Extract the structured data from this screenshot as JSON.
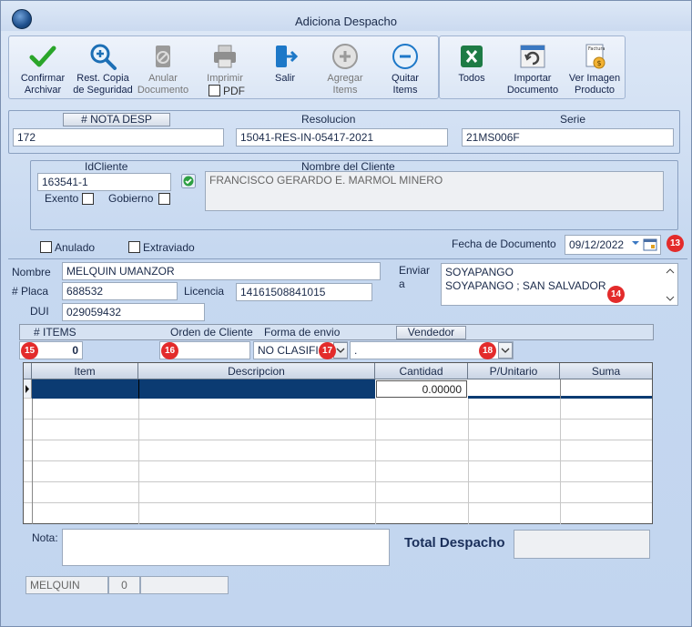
{
  "window": {
    "title": "Adiciona Despacho"
  },
  "toolbar": {
    "confirmar": [
      "Confirmar",
      "Archivar"
    ],
    "rest": [
      "Rest. Copia",
      "de Seguridad"
    ],
    "anular": [
      "Anular",
      "Documento"
    ],
    "imprimir": "Imprimir",
    "pdf": "PDF",
    "salir": "Salir",
    "agregar": [
      "Agregar",
      "Items"
    ],
    "quitar": [
      "Quitar",
      "Items"
    ],
    "todos": "Todos",
    "importar": [
      "Importar",
      "Documento"
    ],
    "ver_imagen": [
      "Ver Imagen",
      "Producto"
    ],
    "factura_mini": "Factura"
  },
  "header": {
    "nota_label": "# NOTA DESP",
    "nota_value": "172",
    "resolucion_label": "Resolucion",
    "resolucion_value": "15041-RES-IN-05417-2021",
    "serie_label": "Serie",
    "serie_value": "21MS006F"
  },
  "cliente": {
    "id_label": "IdCliente",
    "id_value": "163541-1",
    "nombre_label": "Nombre del Cliente",
    "nombre_value": "FRANCISCO GERARDO E. MARMOL MINERO",
    "exento_label": "Exento",
    "gobierno_label": "Gobierno"
  },
  "flags": {
    "anulado": "Anulado",
    "extraviado": "Extraviado"
  },
  "fecha": {
    "label": "Fecha de Documento",
    "value": "09/12/2022"
  },
  "transporte": {
    "nombre_label": "Nombre",
    "nombre_value": "MELQUIN UMANZOR",
    "placa_label": "# Placa",
    "placa_value": "688532",
    "licencia_label": "Licencia",
    "licencia_value": "14161508841015",
    "dui_label": "DUI",
    "dui_value": "029059432"
  },
  "enviar": {
    "label1": "Enviar",
    "label2": "a",
    "line1": "SOYAPANGO",
    "line2": "SOYAPANGO ; SAN SALVADOR"
  },
  "orden": {
    "items_label": "# ITEMS",
    "items_value": "0",
    "orden_label": "Orden de Cliente",
    "forma_label": "Forma de envio",
    "forma_value": "NO CLASIFI",
    "vendedor_label": "Vendedor",
    "vendedor_value": "."
  },
  "grid": {
    "columns": [
      "Item",
      "Descripcion",
      "Cantidad",
      "P/Unitario",
      "Suma"
    ],
    "row_cantidad": "0.00000"
  },
  "footer": {
    "nota_label": "Nota:",
    "total_label": "Total Despacho",
    "user": "MELQUIN",
    "count": "0"
  },
  "badges": [
    "13",
    "14",
    "15",
    "16",
    "17",
    "18"
  ],
  "colors": {
    "grid_selection": "#0b3b72",
    "badge": "#e32b2b"
  }
}
